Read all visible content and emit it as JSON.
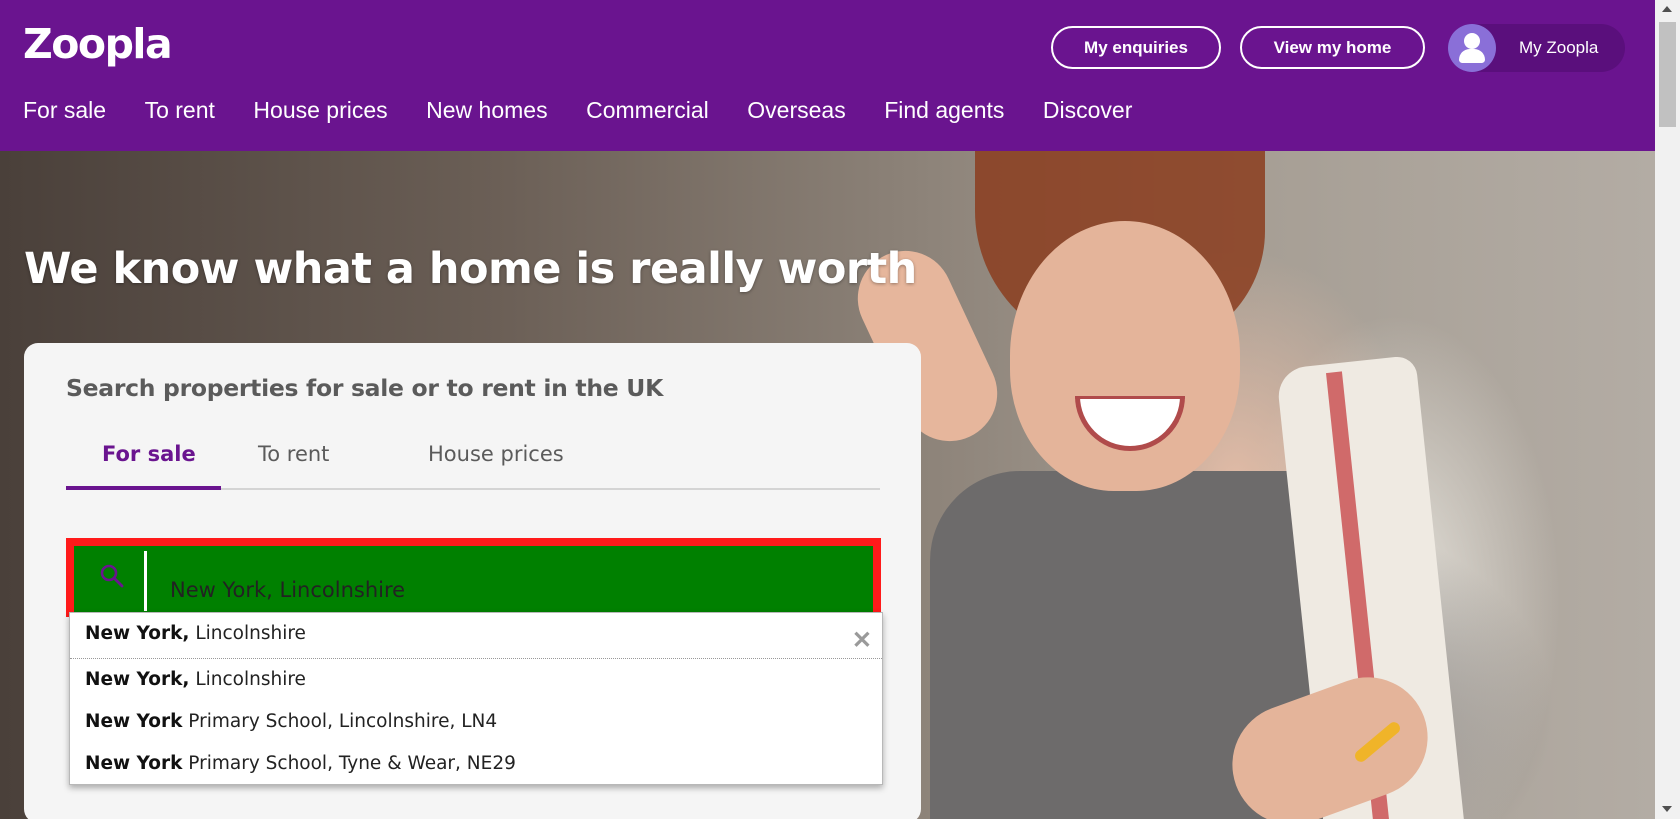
{
  "header": {
    "logo": "Zoopla",
    "buttons": {
      "enquiries": "My enquiries",
      "view_home": "View my home"
    },
    "account": {
      "label": "My Zoopla"
    },
    "nav": [
      "For sale",
      "To rent",
      "House prices",
      "New homes",
      "Commercial",
      "Overseas",
      "Find agents",
      "Discover"
    ]
  },
  "hero": {
    "title": "We know what a home is really worth"
  },
  "search_card": {
    "title": "Search properties for sale or to rent in the UK",
    "tabs": [
      "For sale",
      "To rent",
      "House prices"
    ],
    "active_tab": "For sale",
    "search": {
      "value": "New York, Lincolnshire"
    }
  },
  "dropdown": {
    "current": {
      "bold": "New York,",
      "rest": " Lincolnshire"
    },
    "suggestions": [
      {
        "bold": "New York,",
        "rest": " Lincolnshire"
      },
      {
        "bold": "New York",
        "rest": " Primary School, Lincolnshire, LN4"
      },
      {
        "bold": "New York",
        "rest": " Primary School, Tyne & Wear, NE29"
      }
    ]
  },
  "colors": {
    "brand_purple": "#6a148f",
    "search_highlight": "#008000",
    "search_border": "#ff1a1a"
  },
  "icons": [
    "search-icon",
    "close-icon",
    "user-icon"
  ]
}
